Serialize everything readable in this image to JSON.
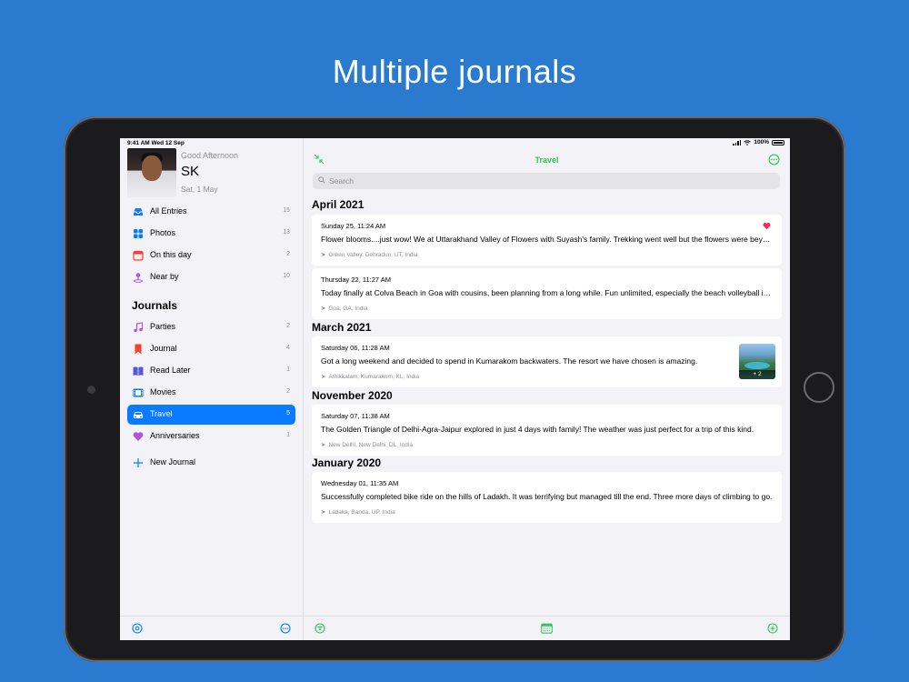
{
  "headline": "Multiple journals",
  "status_bar": {
    "time_date": "9:41 AM  Wed 12 Sep",
    "battery": "100%"
  },
  "profile": {
    "greeting": "Good Afternoon",
    "name": "SK",
    "date": "Sat, 1 May"
  },
  "sidebar": {
    "smart_items": [
      {
        "label": "All Entries",
        "count": "15",
        "icon": "tray-icon",
        "color": "#0a7aff"
      },
      {
        "label": "Photos",
        "count": "13",
        "icon": "photos-grid-icon",
        "color": "#0a7aff"
      },
      {
        "label": "On this day",
        "count": "2",
        "icon": "calendar-icon",
        "color": "#ff3b30"
      },
      {
        "label": "Near by",
        "count": "10",
        "icon": "location-pin-icon",
        "color": "#af52de"
      }
    ],
    "journals_title": "Journals",
    "journals": [
      {
        "label": "Parties",
        "count": "2",
        "icon": "music-notes-icon",
        "color": "#af52de"
      },
      {
        "label": "Journal",
        "count": "4",
        "icon": "bookmark-icon",
        "color": "#ff3b30"
      },
      {
        "label": "Read Later",
        "count": "1",
        "icon": "book-icon",
        "color": "#5856d6"
      },
      {
        "label": "Movies",
        "count": "2",
        "icon": "film-icon",
        "color": "#0a7aff"
      },
      {
        "label": "Travel",
        "count": "5",
        "icon": "car-icon",
        "color": "#ffffff",
        "active": true
      },
      {
        "label": "Anniversaries",
        "count": "1",
        "icon": "heart-icon",
        "color": "#af52de"
      }
    ],
    "new_journal": "New Journal"
  },
  "main": {
    "title": "Travel",
    "search_placeholder": "Search",
    "groups": [
      {
        "month": "April 2021",
        "entries": [
          {
            "date": "Sunday 25, 11:24 AM",
            "text": "Flower blooms....just wow! We at Uttarakhand Valley of Flowers with Suyash's family. Trekking went well but the flowers were beyond description.",
            "location": "Green Valley, Dehradun, UT, India",
            "favorite": true
          },
          {
            "date": "Thursday 22, 11:27 AM",
            "text": "Today finally at Colva Beach in Goa with cousins, been planning from a long while. Fun unlimited, especially the beach volleyball in the evening.",
            "location": "Goa, GA, India"
          }
        ]
      },
      {
        "month": "March 2021",
        "entries": [
          {
            "date": "Saturday 06, 11:28 AM",
            "text": "Got a long weekend and decided to spend in Kumarakom backwaters. The resort we have chosen is amazing.",
            "location": "Athikkalam, Kumarakom, KL, India",
            "photo_more": "+ 2"
          }
        ]
      },
      {
        "month": "November 2020",
        "entries": [
          {
            "date": "Saturday 07, 11:38 AM",
            "text": "The Golden Triangle of Delhi-Agra-Jaipur explored in just 4 days with family! The weather was just perfect for a trip of this kind.",
            "location": "New Delhi, New Delhi, DL, India"
          }
        ]
      },
      {
        "month": "January 2020",
        "entries": [
          {
            "date": "Wednesday 01, 11:35 AM",
            "text": "Successfully completed bike ride on the hills of Ladakh. It was terrifying but managed till the end. Three more days of climbing to go.",
            "location": "Ladaka, Banda, UP, India"
          }
        ]
      }
    ]
  },
  "colors": {
    "accent_blue": "#0a7aff",
    "accent_green": "#34c759",
    "favorite_red": "#ff2d55",
    "background": "#2a7bd0"
  }
}
